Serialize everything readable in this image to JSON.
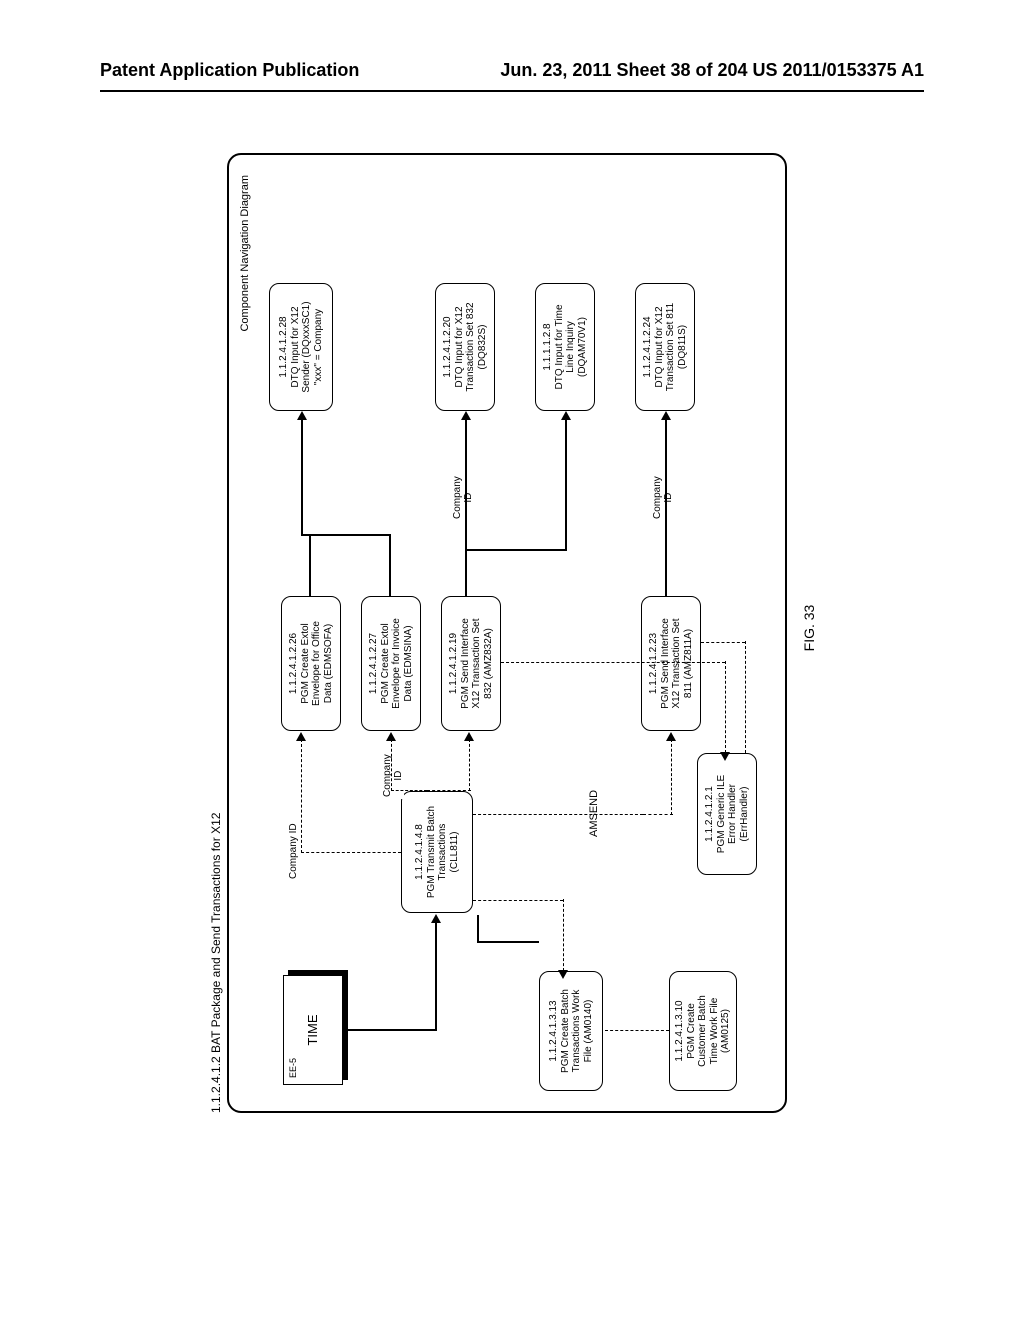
{
  "header": {
    "left": "Patent Application Publication",
    "right": "Jun. 23, 2011  Sheet 38 of 204   US 2011/0153375 A1"
  },
  "diagram": {
    "outer_title": "1.1.2.4.1.2 BAT Package and Send Transactions for X12",
    "nav_title": "Component Navigation Diagram",
    "figure_caption": "FIG. 33",
    "time_box": {
      "ee5": "EE-5",
      "label": "TIME"
    },
    "labels": {
      "company_id": "Company ID",
      "company_id_stacked": "Company\nID",
      "amsend": "AMSEND"
    },
    "boxes": {
      "pgm_cll811": "1.1.2.4.1.4.8\nPGM Transmit Batch\nTransactions\n(CLL811)",
      "pgm_am0140": "1.1.2.4.1.3.13\nPGM Create Batch\nTransactions Work\nFile (AM0140)",
      "pgm_am0125": "1.1.2.4.1.3.10\nPGM Create\nCustomer Batch\nTime Work File\n(AM0125)",
      "pgm_edmsofa": "1.1.2.4.1.2.26\nPGM Create Extol\nEnvelope for Office\nData (EDMSOFA)",
      "pgm_edmsina": "1.1.2.4.1.2.27\nPGM Create Extol\nEnvelope for Invoice\nData (EDMSINA)",
      "pgm_amz832a": "1.1.2.4.1.2.19\nPGM Send Interface\nX12 Transaction Set\n832 (AMZ832A)",
      "pgm_amz811a": "1.1.2.4.1.2.23\nPGM Send Interface\nX12 Transaction Set\n811 (AMZ811A)",
      "pgm_errh": "1.1.2.4.1.2.1\nPGM Generic ILE\nError Handler\n(ErrHandler)",
      "dtq_sender": "1.1.2.4.1.2.28\nDTQ Input for X12\nSender (DQxxxSC1)\n\"xxx\" = Company",
      "dtq_832": "1.1.2.4.1.2.20\nDTQ Input for X12\nTransaction Set 832\n(DQ832S)",
      "dtq_time": "1.1.1.1.2.8\nDTQ Input for Time\nLine Inquiry\n(DQAM70V1)",
      "dtq_811": "1.1.2.4.1.2.24\nDTQ Input for X12\nTransaction Set 811\n(DQ811S)"
    }
  }
}
